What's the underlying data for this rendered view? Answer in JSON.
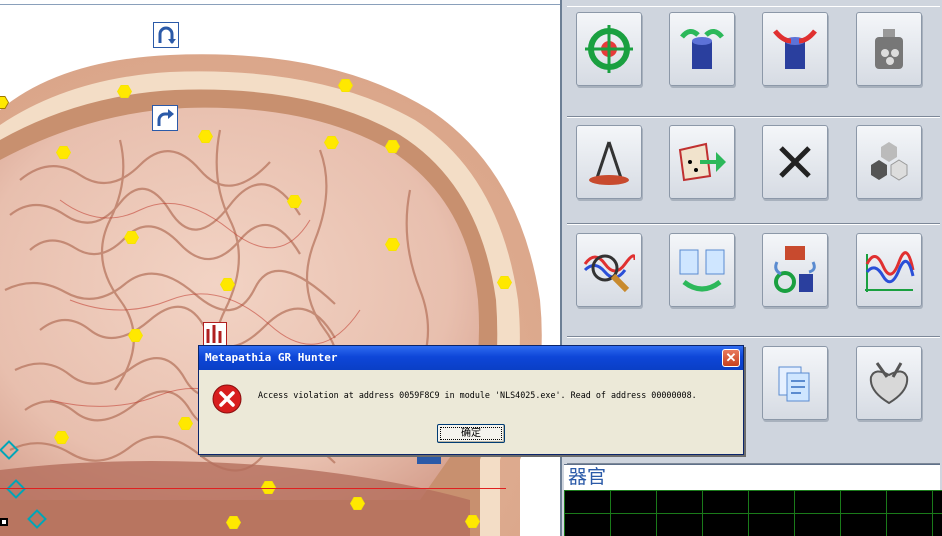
{
  "dialog": {
    "title": "Metapathia GR Hunter",
    "message": "Access violation at address 0059F8C9 in module 'NLS4025.exe'. Read of address 00000008.",
    "ok_label": "确定",
    "close_glyph": "✕"
  },
  "organ_panel": {
    "label": "器官"
  },
  "tools": [
    {
      "icon": "crosshair-target-icon"
    },
    {
      "icon": "cylinder-arrows-out-icon"
    },
    {
      "icon": "cylinder-arrows-in-icon"
    },
    {
      "icon": "cylinder-device-icon"
    },
    {
      "icon": "compass-drawing-icon"
    },
    {
      "icon": "map-arrow-icon"
    },
    {
      "icon": "close-x-icon"
    },
    {
      "icon": "hexagon-cells-icon"
    },
    {
      "icon": "magnifier-wave-icon"
    },
    {
      "icon": "clipboard-swap-icon"
    },
    {
      "icon": "remedy-transfer-icon"
    },
    {
      "icon": "waveform-graph-icon"
    },
    {
      "icon": "documents-icon"
    },
    {
      "icon": "heart-anatomy-icon"
    }
  ],
  "colors": {
    "marker": "#ffe800",
    "dialog_title": "#0e46d8",
    "error_red": "#d81e1e",
    "grid_green": "#1a7a1a",
    "panel_bg": "#cfd5de"
  }
}
